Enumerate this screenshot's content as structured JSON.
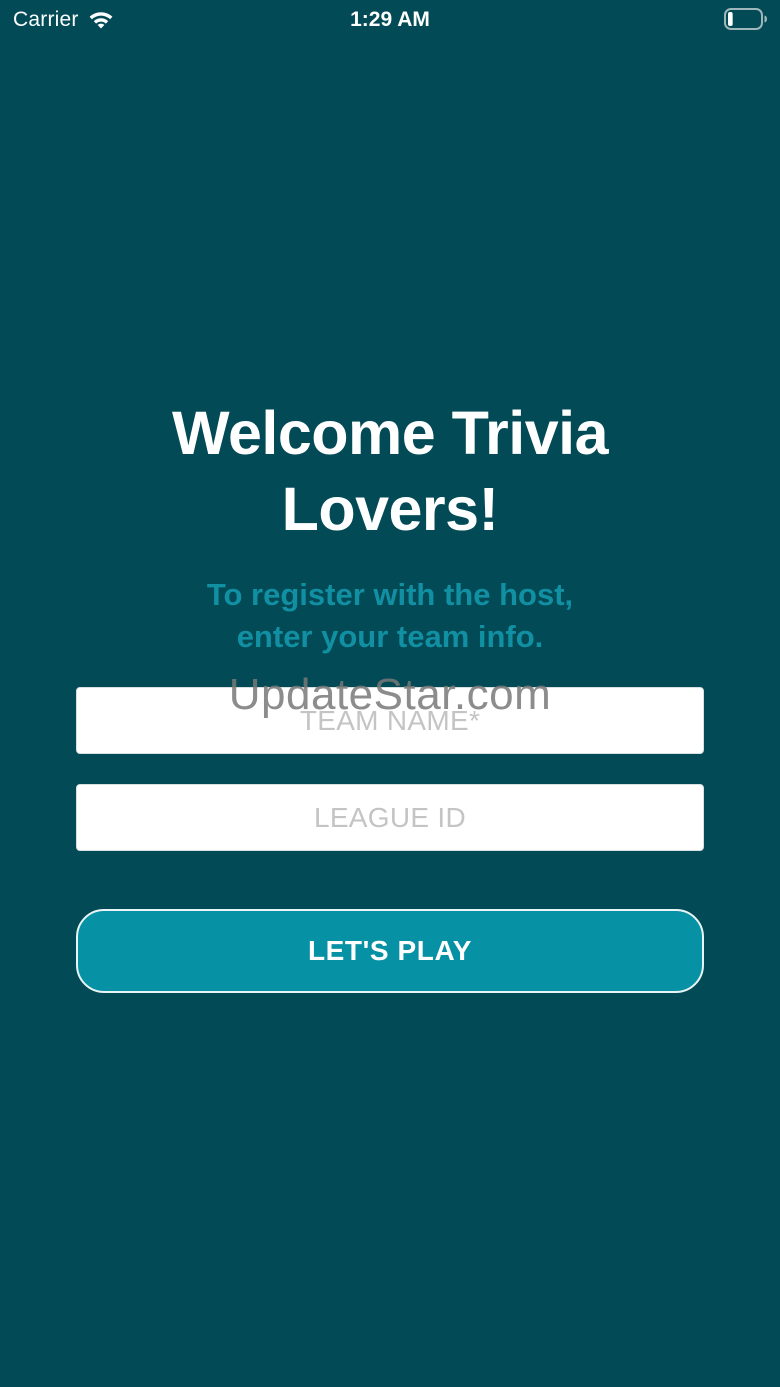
{
  "status_bar": {
    "carrier": "Carrier",
    "time": "1:29 AM",
    "icons": {
      "signal": "wifi-icon",
      "battery": "battery-icon"
    },
    "battery_level": 0.15
  },
  "welcome": {
    "title_line1": "Welcome Trivia",
    "title_line2": "Lovers!",
    "subtitle_line1": "To register with the host,",
    "subtitle_line2": "enter your team info."
  },
  "form": {
    "team_name": {
      "value": "",
      "placeholder": "TEAM NAME*"
    },
    "league_id": {
      "value": "",
      "placeholder": "LEAGUE ID"
    },
    "submit_label": "LET'S PLAY"
  },
  "watermark": "UpdateStar.com",
  "colors": {
    "background": "#024a55",
    "accent": "#0791a5",
    "subtitle": "#1290a3",
    "text": "#ffffff"
  }
}
